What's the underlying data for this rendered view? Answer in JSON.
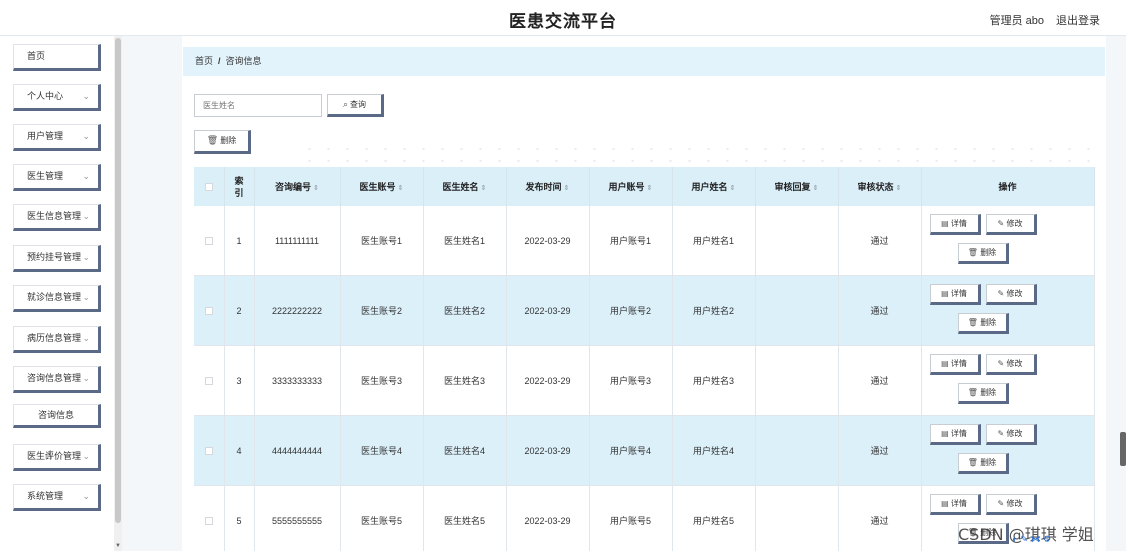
{
  "header": {
    "title": "医患交流平台",
    "user": "管理员 abo",
    "logout": "退出登录"
  },
  "sidebar": {
    "items": [
      {
        "label": "首页",
        "chevron": false
      },
      {
        "label": "个人中心",
        "chevron": true
      },
      {
        "label": "用户管理",
        "chevron": true
      },
      {
        "label": "医生管理",
        "chevron": true
      },
      {
        "label": "医生信息管理",
        "chevron": true
      },
      {
        "label": "预约挂号管理",
        "chevron": true
      },
      {
        "label": "就诊信息管理",
        "chevron": true
      },
      {
        "label": "病历信息管理",
        "chevron": true
      },
      {
        "label": "咨询信息管理",
        "chevron": true
      },
      {
        "label": "咨询信息",
        "sub": true
      },
      {
        "label": "医生评价管理",
        "chevron": true
      },
      {
        "label": "系统管理",
        "chevron": true
      }
    ]
  },
  "breadcrumb": {
    "home": "首页",
    "separator": "/",
    "current": "咨询信息"
  },
  "search": {
    "placeholder": "医生姓名",
    "button_label": "查询",
    "button_icon": "search-icon"
  },
  "toolbar": {
    "delete_label": "删除",
    "delete_icon": "trash-icon"
  },
  "table": {
    "columns": [
      "索引",
      "咨询编号",
      "医生账号",
      "医生姓名",
      "发布时间",
      "用户账号",
      "用户姓名",
      "审核回复",
      "审核状态",
      "操作"
    ],
    "sortable": [
      false,
      true,
      true,
      true,
      true,
      true,
      true,
      true,
      true,
      false
    ],
    "rows": [
      {
        "index": "1",
        "id": "1111111111",
        "doctor_account": "医生账号1",
        "doctor_name": "医生姓名1",
        "time": "2022-03-29",
        "user_account": "用户账号1",
        "user_name": "用户姓名1",
        "reply": "",
        "status": "通过"
      },
      {
        "index": "2",
        "id": "2222222222",
        "doctor_account": "医生账号2",
        "doctor_name": "医生姓名2",
        "time": "2022-03-29",
        "user_account": "用户账号2",
        "user_name": "用户姓名2",
        "reply": "",
        "status": "通过"
      },
      {
        "index": "3",
        "id": "3333333333",
        "doctor_account": "医生账号3",
        "doctor_name": "医生姓名3",
        "time": "2022-03-29",
        "user_account": "用户账号3",
        "user_name": "用户姓名3",
        "reply": "",
        "status": "通过"
      },
      {
        "index": "4",
        "id": "4444444444",
        "doctor_account": "医生账号4",
        "doctor_name": "医生姓名4",
        "time": "2022-03-29",
        "user_account": "用户账号4",
        "user_name": "用户姓名4",
        "reply": "",
        "status": "通过"
      },
      {
        "index": "5",
        "id": "5555555555",
        "doctor_account": "医生账号5",
        "doctor_name": "医生姓名5",
        "time": "2022-03-29",
        "user_account": "用户账号5",
        "user_name": "用户姓名5",
        "reply": "",
        "status": "通过"
      }
    ],
    "actions": {
      "detail": "详情",
      "edit": "修改",
      "delete": "删除"
    }
  },
  "watermark": "CSDN @琪琪 学姐",
  "colors": {
    "header_bg": "#ffffff",
    "row_alt": "#dcf0fa",
    "table_head": "#dbeff9",
    "button_shadow": "#5a6a86"
  }
}
